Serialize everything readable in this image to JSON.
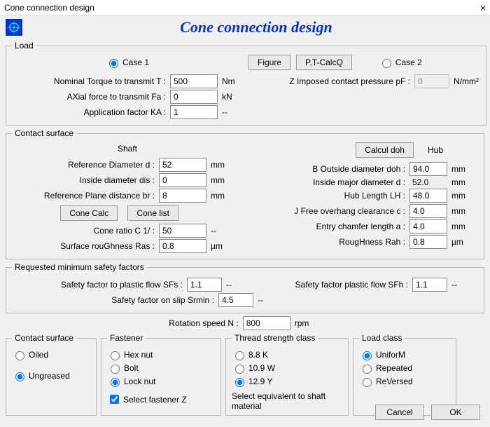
{
  "window": {
    "title": "Cone connection design",
    "close": "×"
  },
  "header": {
    "title": "Cone connection design"
  },
  "load": {
    "legend": "Load",
    "case1": "Case 1",
    "figure_btn": "Figure",
    "ptcalc_btn": "P,T-CalcQ",
    "case2": "Case 2",
    "nominal_torque_lbl": "Nominal Torque to transmit   T   :",
    "nominal_torque_val": "500",
    "nominal_torque_unit": "Nm",
    "axial_force_lbl": "AXial force to transmit   Fa :",
    "axial_force_val": "0",
    "axial_force_unit": "kN",
    "app_factor_lbl": "Application factor   KA :",
    "app_factor_val": "1",
    "app_factor_unit": "--",
    "z_lbl": "Z Imposed contact pressure   pF  :",
    "z_val": "0",
    "z_unit": "N/mm²"
  },
  "cs": {
    "legend": "Contact surface",
    "shaft_head": "Shaft",
    "hub_head": "Hub",
    "calcul_btn": "Calcul doh",
    "ref_dia_lbl": "Reference Diameter   d   :",
    "ref_dia_val": "52",
    "mm": "mm",
    "inside_dia_lbl": "Inside diameter   dis :",
    "inside_dia_val": "0",
    "plane_lbl": "Reference Plane distance   br :",
    "plane_val": "8",
    "cone_calc_btn": "Cone Calc",
    "cone_list_btn": "Cone list",
    "cone_ratio_lbl": "Cone ratio   C  1/ :",
    "cone_ratio_val": "50",
    "cone_ratio_unit": "--",
    "ras_lbl": "Surface rouGhness   Ras :",
    "ras_val": "0.8",
    "um": "µm",
    "b_out_lbl": "B Outside diameter   doh :",
    "b_out_val": "94.0",
    "inmaj_lbl": "Inside major diameter   d :",
    "inmaj_val": "52.0",
    "hublen_lbl": "Hub Length   LH :",
    "hublen_val": "48.0",
    "clear_lbl": "J Free overhang clearance    c :",
    "clear_val": "4.0",
    "chamfer_lbl": "Entry chamfer length    a :",
    "chamfer_val": "4.0",
    "rah_lbl": "RougHness   Rah :",
    "rah_val": "0.8"
  },
  "sf": {
    "legend": "Requested minimum safety factors",
    "sfs_lbl": "Safety factor to plastic flow   SFs :",
    "sfs_val": "1.1",
    "dd": "--",
    "sfh_lbl": "Safety factor plastic flow   SFh :",
    "sfh_val": "1.1",
    "srmin_lbl": "Safety factor on slip   Srmin :",
    "srmin_val": "4.5"
  },
  "rot": {
    "lbl": "Rotation speed   N   :",
    "val": "800",
    "unit": "rpm"
  },
  "surf": {
    "legend": "Contact surface",
    "oiled": "Oiled",
    "ungreased": "Ungreased"
  },
  "fast": {
    "legend": "Fastener",
    "hex": "Hex nut",
    "bolt": "Bolt",
    "lock": "Lock nut",
    "selz": "Select fastener Z"
  },
  "thr": {
    "legend": "Thread strength class",
    "k": "8.8    K",
    "w": "10.9  W",
    "y": "12.9  Y",
    "note": "Select equivalent to shaft material"
  },
  "lc": {
    "legend": "Load class",
    "uni": "UniforM",
    "rep": "Repeated",
    "rev": "ReVersed"
  },
  "footer": {
    "cancel": "Cancel",
    "ok": "OK"
  }
}
